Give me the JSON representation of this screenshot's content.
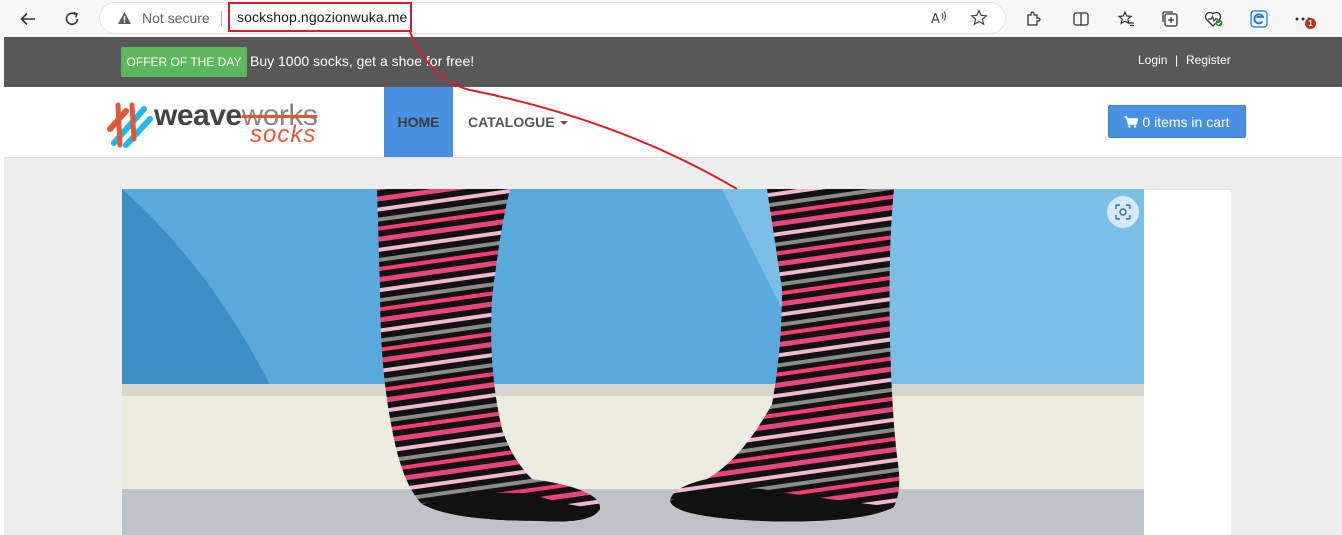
{
  "browser": {
    "security_label": "Not secure",
    "url": "sockshop.ngozionwuka.me",
    "notification_count": "1",
    "icons": [
      "back-icon",
      "refresh-icon",
      "warning-icon",
      "read-aloud-icon",
      "favorite-star-icon",
      "extensions-icon",
      "split-screen-icon",
      "favorites-icon",
      "collections-icon",
      "browser-essentials-icon",
      "edge-icon",
      "more-icon"
    ]
  },
  "topbar": {
    "offer_label": "OFFER OF THE DAY",
    "offer_text": "Buy 1000 socks, get a shoe for free!",
    "login": "Login",
    "separator": "|",
    "register": "Register"
  },
  "navbar": {
    "logo_weave": "weave",
    "logo_works": "works",
    "logo_socks": "socks",
    "home": "HOME",
    "catalogue": "CATALOGUE",
    "cart": "0 items in cart"
  },
  "hero": {
    "visual_search_icon": "visual-search-icon"
  },
  "colors": {
    "annotation_red": "#d32029",
    "brand_blue": "#4a90e2",
    "offer_green": "#5cb85c",
    "topbar_gray": "#585858"
  }
}
